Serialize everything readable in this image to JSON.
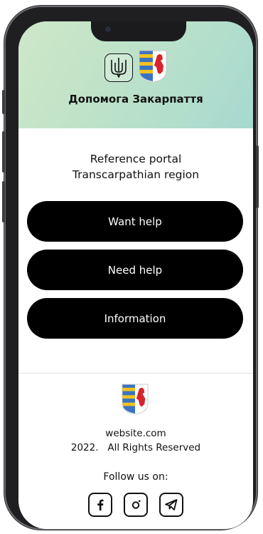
{
  "header": {
    "title": "Допомога Закарпаття",
    "emblem_icon": "ukraine-trident-icon",
    "regional_icon": "transcarpathia-coat-of-arms-icon"
  },
  "main": {
    "subtitle_line1": "Reference portal",
    "subtitle_line2": "Transcarpathian region",
    "buttons": [
      {
        "label": "Want help"
      },
      {
        "label": "Need help"
      },
      {
        "label": "Information"
      }
    ]
  },
  "footer": {
    "logo_icon": "transcarpathia-coat-of-arms-icon",
    "site": "website.com",
    "copyright": "2022.   All Rights Reserved",
    "follow": "Follow us on:",
    "socials": [
      "facebook-icon",
      "instagram-icon",
      "telegram-icon"
    ]
  },
  "colors": {
    "header_gradient_start": "#cfe7c9",
    "header_gradient_end": "#a7d9d0",
    "button_bg": "#000000",
    "button_text": "#ffffff",
    "coat_yellow": "#f3c21d",
    "coat_blue": "#3b73c2",
    "coat_red": "#d8232a"
  }
}
